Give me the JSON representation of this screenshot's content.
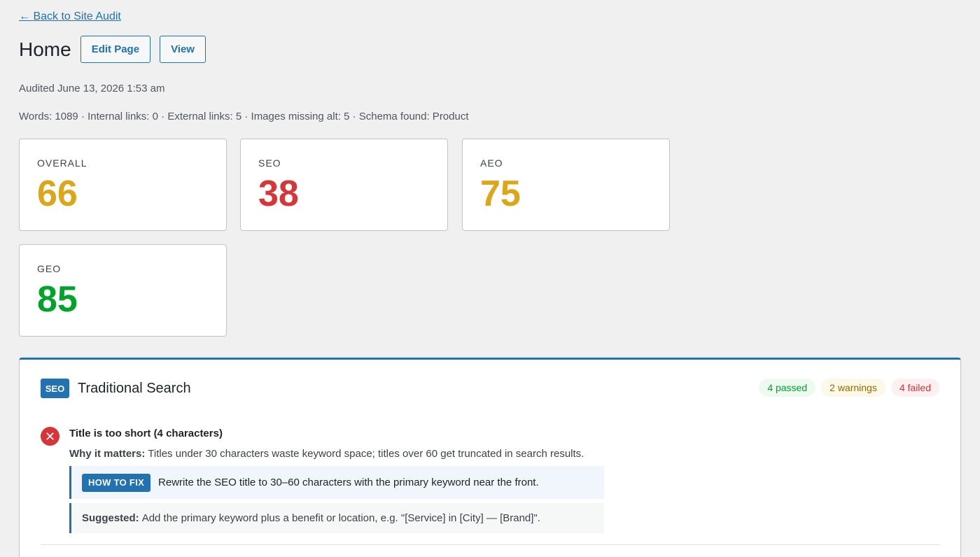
{
  "nav": {
    "back_label": "← Back to Site Audit"
  },
  "header": {
    "title": "Home",
    "edit_label": "Edit Page",
    "view_label": "View"
  },
  "audited": "Audited June 13, 2026 1:53 am",
  "stats": "Words: 1089 · Internal links: 0 · External links: 5 · Images missing alt: 5 · Schema found: Product",
  "scores": [
    {
      "label": "OVERALL",
      "value": "66",
      "color": "#dba617"
    },
    {
      "label": "SEO",
      "value": "38",
      "color": "#d63638"
    },
    {
      "label": "AEO",
      "value": "75",
      "color": "#dba617"
    },
    {
      "label": "GEO",
      "value": "85",
      "color": "#00a32a"
    }
  ],
  "section": {
    "badge": "SEO",
    "title": "Traditional Search",
    "passed": "4 passed",
    "warnings": "2 warnings",
    "failed": "4 failed",
    "issue": {
      "icon": "error-icon",
      "title": "Title is too short (4 characters)",
      "why_label": "Why it matters:",
      "why_text": " Titles under 30 characters waste keyword space; titles over 60 get truncated in search results.",
      "fix_tag": "HOW TO FIX",
      "fix_text": "Rewrite the SEO title to 30–60 characters with the primary keyword near the front.",
      "suggest_label": "Suggested:",
      "suggest_text": "Add the primary keyword plus a benefit or location, e.g. \"[Service] in [City] — [Brand]\"."
    }
  }
}
